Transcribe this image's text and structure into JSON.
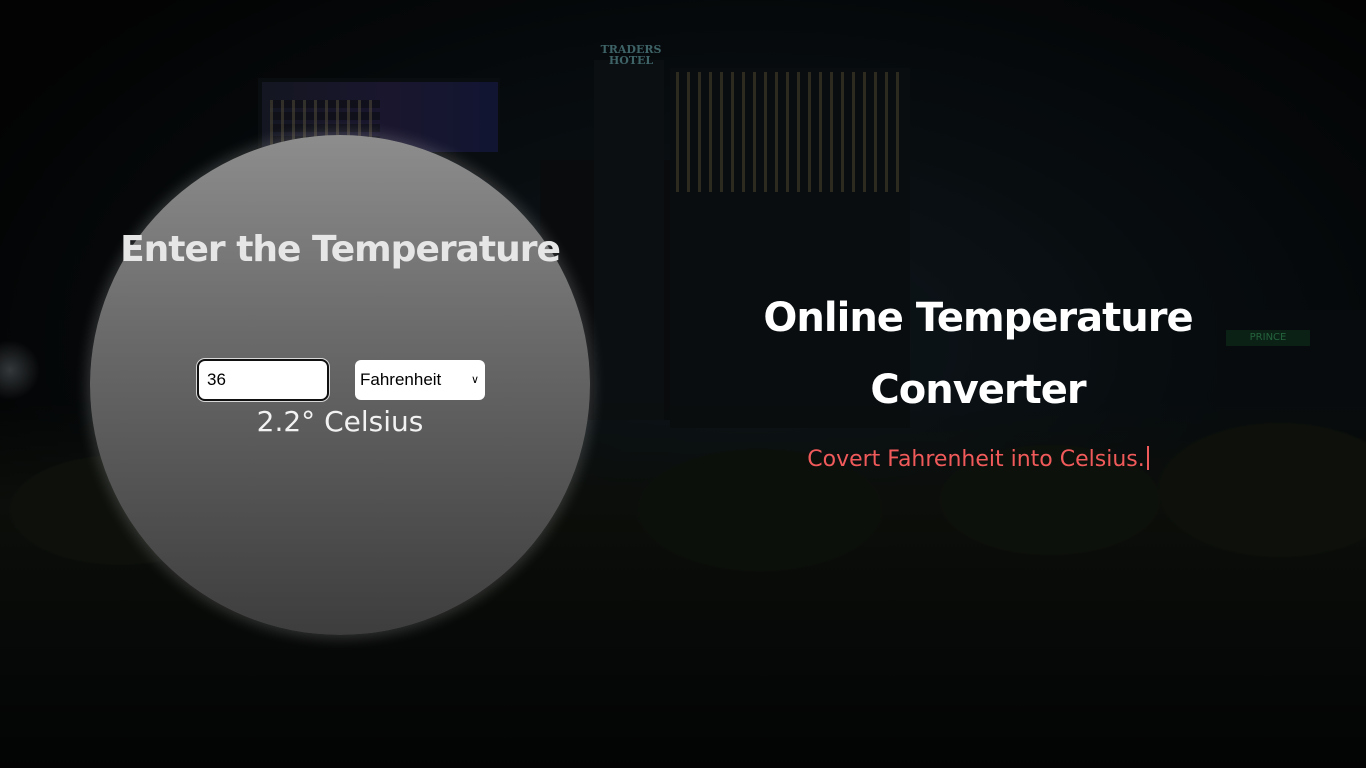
{
  "background": {
    "signs": {
      "traders_hotel": "TRADERS HOTEL",
      "prince": "PRINCE"
    }
  },
  "converter": {
    "heading": "Enter the Temperature",
    "input": {
      "value": "36"
    },
    "unit_select": {
      "selected": "Fahrenheit"
    },
    "result": "2.2° Celsius"
  },
  "info": {
    "title": "Online Temperature Converter",
    "subtitle": "Covert Fahrenheit into Celsius."
  },
  "colors": {
    "subtitle": "#f15a5a",
    "title": "#ffffff",
    "heading": "#e6e6e6"
  }
}
